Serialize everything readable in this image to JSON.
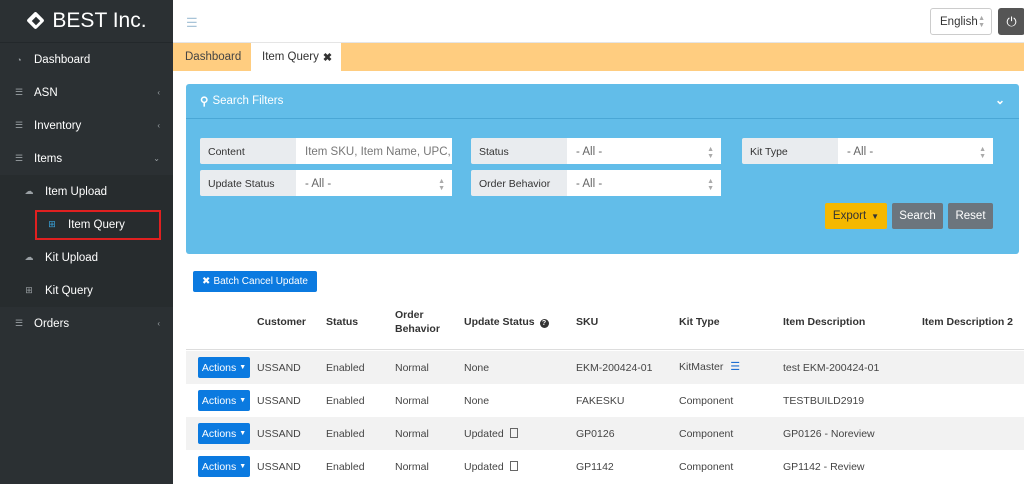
{
  "brand": {
    "name": "BEST Inc."
  },
  "sidebar": {
    "items": [
      {
        "label": "Dashboard"
      },
      {
        "label": "ASN"
      },
      {
        "label": "Inventory"
      },
      {
        "label": "Items"
      },
      {
        "label": "Item Upload"
      },
      {
        "label": "Item Query"
      },
      {
        "label": "Kit Upload"
      },
      {
        "label": "Kit Query"
      },
      {
        "label": "Orders"
      }
    ]
  },
  "topbar": {
    "language": "English"
  },
  "tabs": [
    {
      "label": "Dashboard"
    },
    {
      "label": "Item Query"
    }
  ],
  "filters": {
    "title": "Search Filters",
    "content_label": "Content",
    "content_placeholder": "Item SKU, Item Name, UPC,",
    "status_label": "Status",
    "status_value": "- All -",
    "kit_type_label": "Kit Type",
    "kit_type_value": "- All -",
    "update_status_label": "Update Status",
    "update_status_value": "- All -",
    "order_behavior_label": "Order Behavior",
    "order_behavior_value": "- All -",
    "export_label": "Export",
    "search_label": "Search",
    "reset_label": "Reset"
  },
  "batch_cancel_label": "Batch Cancel Update",
  "table": {
    "headers": {
      "customer": "Customer",
      "status": "Status",
      "order_behavior_1": "Order",
      "order_behavior_2": "Behavior",
      "update_status": "Update Status",
      "sku": "SKU",
      "kit_type": "Kit Type",
      "item_description": "Item Description",
      "item_description_2": "Item Description 2"
    },
    "action_label": "Actions",
    "rows": [
      {
        "customer": "USSAND",
        "status": "Enabled",
        "order_behavior": "Normal",
        "update_status": "None",
        "sku": "EKM-200424-01",
        "kit_type": "KitMaster",
        "desc": "test EKM-200424-01"
      },
      {
        "customer": "USSAND",
        "status": "Enabled",
        "order_behavior": "Normal",
        "update_status": "None",
        "sku": "FAKESKU",
        "kit_type": "Component",
        "desc": "TESTBUILD2919"
      },
      {
        "customer": "USSAND",
        "status": "Enabled",
        "order_behavior": "Normal",
        "update_status": "Updated",
        "sku": "GP0126",
        "kit_type": "Component",
        "desc": "GP0126 - Noreview"
      },
      {
        "customer": "USSAND",
        "status": "Enabled",
        "order_behavior": "Normal",
        "update_status": "Updated",
        "sku": "GP1142",
        "kit_type": "Component",
        "desc": "GP1142 - Review"
      }
    ]
  }
}
